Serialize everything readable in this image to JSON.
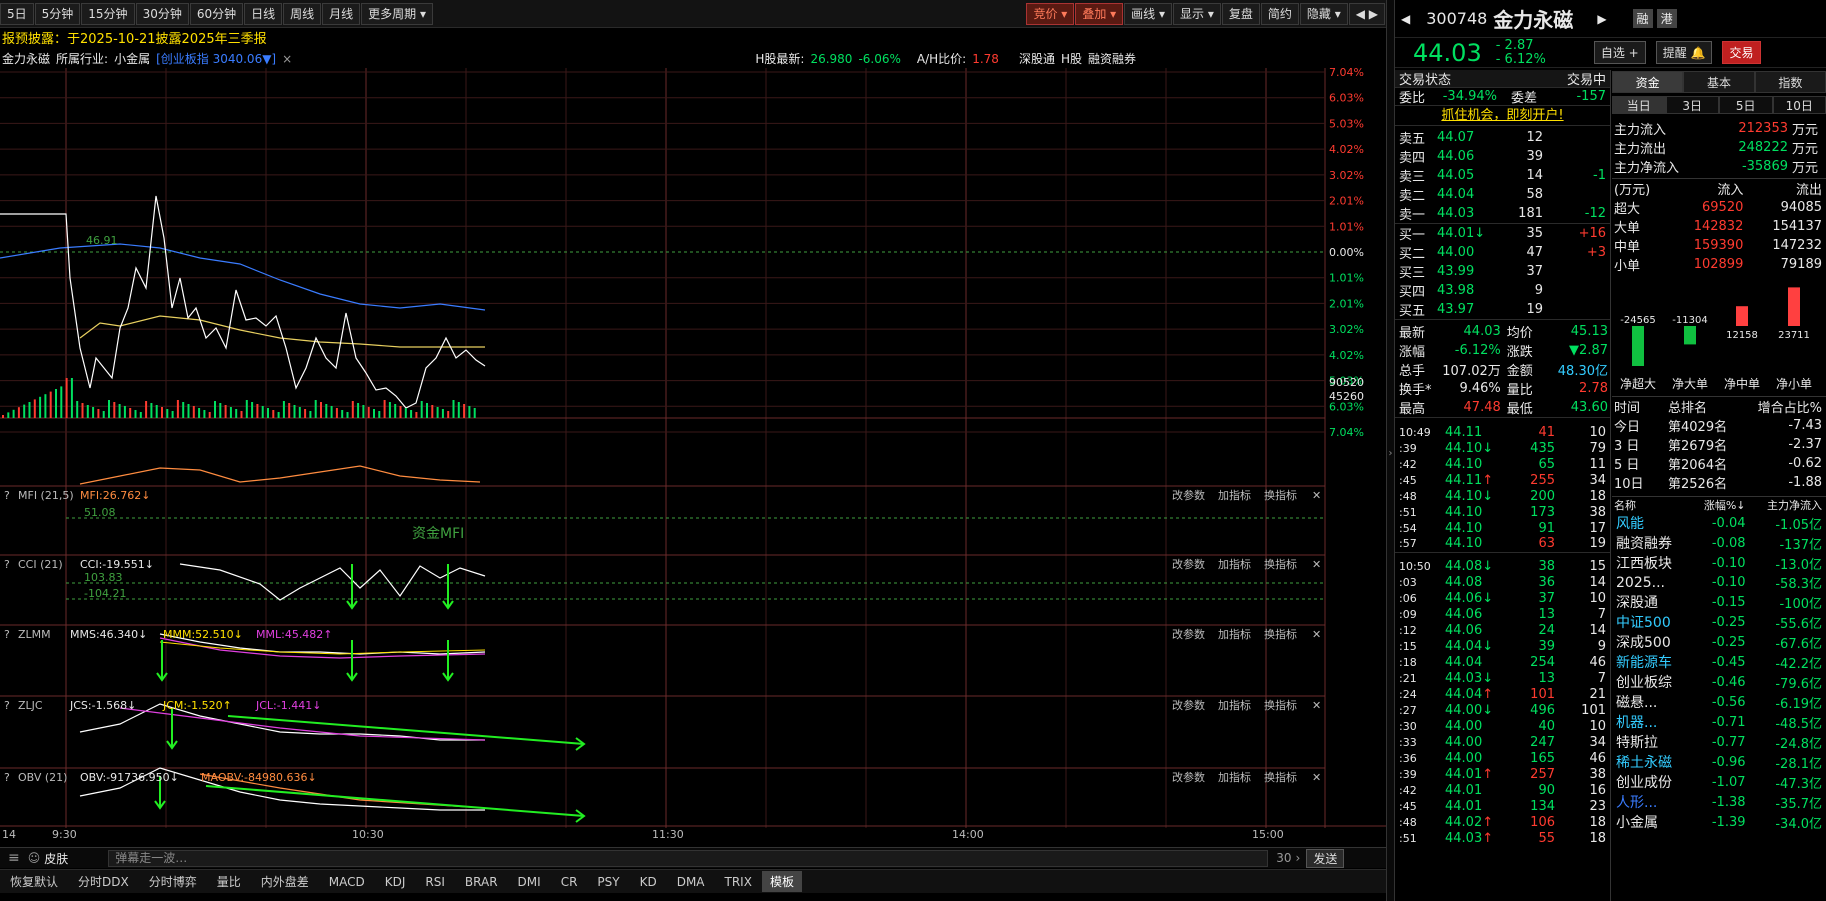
{
  "toolbar": {
    "left_buttons": [
      "5日",
      "5分钟",
      "15分钟",
      "30分钟",
      "60分钟",
      "日线",
      "周线",
      "月线",
      "更多周期"
    ],
    "right_buttons": [
      "竞价",
      "叠加",
      "画线",
      "显示",
      "复盘",
      "简约",
      "隐藏"
    ],
    "arrows": "◀ ▶"
  },
  "info_line": "报预披露：于2025-10-21披露2025年三季报",
  "chart_header": {
    "stock": "金力永磁",
    "industry_label": "所属行业:",
    "industry": "小金属",
    "index_tag": "[创业板指 3040.06▼]",
    "close": "×",
    "h_label": "H股最新:",
    "h_price": "26.980",
    "h_change": "-6.06%",
    "ah_label": "A/H比价:",
    "ah_value": "1.78",
    "links": [
      "深股通",
      "H股",
      "融资融券"
    ]
  },
  "chart": {
    "left_edge_label": "14",
    "time_labels": [
      "9:30",
      "10:30",
      "11:30",
      "14:00",
      "15:00"
    ],
    "right_axis": [
      "7.04%",
      "6.03%",
      "5.03%",
      "4.02%",
      "3.02%",
      "2.01%",
      "1.01%",
      "0.00%",
      "1.01%",
      "2.01%",
      "3.02%",
      "4.02%",
      "5.03%",
      "6.03%",
      "7.04%"
    ],
    "ref_line_label": "46.91",
    "volume_axis": [
      "90520",
      "45260"
    ],
    "panel_tools": [
      "改参数",
      "加指标",
      "换指标"
    ],
    "panels": [
      {
        "name": "MFI (21,5)",
        "values": [
          {
            "text": "MFI:26.762↓",
            "color": "#ff8c40"
          }
        ],
        "levels": [
          "51.08"
        ],
        "annotation": "资金MFI"
      },
      {
        "name": "CCI (21)",
        "values": [
          {
            "text": "CCI:-19.551↓",
            "color": "#e8e8e8"
          }
        ],
        "levels": [
          "103.83",
          "-104.21"
        ],
        "annotation": ""
      },
      {
        "name": "ZLMM",
        "values": [
          {
            "text": "MMS:46.340↓",
            "color": "#e8e8e8"
          },
          {
            "text": "MMM:52.510↓",
            "color": "#ffe000"
          },
          {
            "text": "MML:45.482↑",
            "color": "#e040e0"
          }
        ],
        "levels": [],
        "annotation": ""
      },
      {
        "name": "ZLJC",
        "values": [
          {
            "text": "JCS:-1.568↓",
            "color": "#e8e8e8"
          },
          {
            "text": "JCM:-1.520↑",
            "color": "#ffe000"
          },
          {
            "text": "JCL:-1.441↓",
            "color": "#e040e0"
          }
        ],
        "levels": [],
        "annotation": ""
      },
      {
        "name": "OBV (21)",
        "values": [
          {
            "text": "OBV:-91736.950↓",
            "color": "#e8e8e8"
          },
          {
            "text": "MAOBV:-84980.636↓",
            "color": "#ff8c40"
          }
        ],
        "levels": [],
        "annotation": ""
      }
    ]
  },
  "comment_bar": {
    "skin": "皮肤",
    "placeholder": "弹幕走一波…",
    "count": "30",
    "send": "发送"
  },
  "indicator_tabs": [
    "恢复默认",
    "分时DDX",
    "分时博弈",
    "量比",
    "内外盘差",
    "MACD",
    "KDJ",
    "RSI",
    "BRAR",
    "DMI",
    "CR",
    "PSY",
    "KD",
    "DMA",
    "TRIX",
    "模板"
  ],
  "right": {
    "code": "300748",
    "name": "金力永磁",
    "tags": [
      "融",
      "港"
    ],
    "price": "44.03",
    "change": "- 2.87",
    "change_pct": "- 6.12%",
    "buttons": [
      "自选 +",
      "提醒 🔔",
      "交易"
    ],
    "status_label": "交易状态",
    "status": "交易中",
    "weibi_label": "委比",
    "weibi": "-34.94%",
    "weicha_label": "委差",
    "weicha": "-157",
    "promo": "抓住机会，即刻开户!",
    "asks": [
      {
        "label": "卖五",
        "price": "44.07",
        "vol": "12",
        "chg": ""
      },
      {
        "label": "卖四",
        "price": "44.06",
        "vol": "39",
        "chg": ""
      },
      {
        "label": "卖三",
        "price": "44.05",
        "vol": "14",
        "chg": "-1"
      },
      {
        "label": "卖二",
        "price": "44.04",
        "vol": "58",
        "chg": ""
      },
      {
        "label": "卖一",
        "price": "44.03",
        "vol": "181",
        "chg": "-12"
      }
    ],
    "bids": [
      {
        "label": "买一",
        "price": "44.01↓",
        "vol": "35",
        "chg": "+16"
      },
      {
        "label": "买二",
        "price": "44.00",
        "vol": "47",
        "chg": "+3"
      },
      {
        "label": "买三",
        "price": "43.99",
        "vol": "37",
        "chg": ""
      },
      {
        "label": "买四",
        "price": "43.98",
        "vol": "9",
        "chg": ""
      },
      {
        "label": "买五",
        "price": "43.97",
        "vol": "19",
        "chg": ""
      }
    ],
    "stats": [
      [
        {
          "l": "最新",
          "v": "44.03",
          "c": "green"
        },
        {
          "l": "均价",
          "v": "45.13",
          "c": "green"
        }
      ],
      [
        {
          "l": "涨幅",
          "v": "-6.12%",
          "c": "green"
        },
        {
          "l": "涨跌",
          "v": "▼2.87",
          "c": "green"
        }
      ],
      [
        {
          "l": "总手",
          "v": "107.02万",
          "c": "white"
        },
        {
          "l": "金额",
          "v": "48.30亿",
          "c": "cyan"
        }
      ],
      [
        {
          "l": "换手*",
          "v": "9.46%",
          "c": "white"
        },
        {
          "l": "量比",
          "v": "2.78",
          "c": "red"
        }
      ],
      [
        {
          "l": "最高",
          "v": "47.48",
          "c": "red"
        },
        {
          "l": "最低",
          "v": "43.60",
          "c": "green"
        }
      ]
    ],
    "ticks1": [
      {
        "t": "10:49",
        "p": "44.11",
        "a": "",
        "v": "41",
        "vc": "red",
        "n": "10"
      },
      {
        "t": ":39",
        "p": "44.10",
        "a": "↓",
        "v": "435",
        "vc": "green",
        "n": "79"
      },
      {
        "t": ":42",
        "p": "44.10",
        "a": "",
        "v": "65",
        "vc": "green",
        "n": "11"
      },
      {
        "t": ":45",
        "p": "44.11",
        "a": "↑",
        "v": "255",
        "vc": "red",
        "n": "34"
      },
      {
        "t": ":48",
        "p": "44.10",
        "a": "↓",
        "v": "200",
        "vc": "green",
        "n": "18"
      },
      {
        "t": ":51",
        "p": "44.10",
        "a": "",
        "v": "173",
        "vc": "green",
        "n": "38"
      },
      {
        "t": ":54",
        "p": "44.10",
        "a": "",
        "v": "91",
        "vc": "green",
        "n": "17"
      },
      {
        "t": ":57",
        "p": "44.10",
        "a": "",
        "v": "63",
        "vc": "red",
        "n": "19"
      }
    ],
    "ticks2": [
      {
        "t": "10:50",
        "p": "44.08",
        "a": "↓",
        "v": "38",
        "vc": "green",
        "n": "15"
      },
      {
        "t": ":03",
        "p": "44.08",
        "a": "",
        "v": "36",
        "vc": "green",
        "n": "14"
      },
      {
        "t": ":06",
        "p": "44.06",
        "a": "↓",
        "v": "37",
        "vc": "green",
        "n": "10"
      },
      {
        "t": ":09",
        "p": "44.06",
        "a": "",
        "v": "13",
        "vc": "green",
        "n": "7"
      },
      {
        "t": ":12",
        "p": "44.06",
        "a": "",
        "v": "24",
        "vc": "green",
        "n": "14"
      },
      {
        "t": ":15",
        "p": "44.04",
        "a": "↓",
        "v": "39",
        "vc": "green",
        "n": "9"
      },
      {
        "t": ":18",
        "p": "44.04",
        "a": "",
        "v": "254",
        "vc": "green",
        "n": "46"
      },
      {
        "t": ":21",
        "p": "44.03",
        "a": "↓",
        "v": "13",
        "vc": "green",
        "n": "7"
      },
      {
        "t": ":24",
        "p": "44.04",
        "a": "↑",
        "v": "101",
        "vc": "red",
        "n": "21"
      },
      {
        "t": ":27",
        "p": "44.00",
        "a": "↓",
        "v": "496",
        "vc": "green",
        "n": "101"
      },
      {
        "t": ":30",
        "p": "44.00",
        "a": "",
        "v": "40",
        "vc": "green",
        "n": "10"
      },
      {
        "t": ":33",
        "p": "44.00",
        "a": "",
        "v": "247",
        "vc": "green",
        "n": "34"
      },
      {
        "t": ":36",
        "p": "44.00",
        "a": "",
        "v": "165",
        "vc": "green",
        "n": "46"
      },
      {
        "t": ":39",
        "p": "44.01",
        "a": "↑",
        "v": "257",
        "vc": "red",
        "n": "38"
      },
      {
        "t": ":42",
        "p": "44.01",
        "a": "",
        "v": "90",
        "vc": "green",
        "n": "16"
      },
      {
        "t": ":45",
        "p": "44.01",
        "a": "",
        "v": "134",
        "vc": "green",
        "n": "23"
      },
      {
        "t": ":48",
        "p": "44.02",
        "a": "↑",
        "v": "106",
        "vc": "red",
        "n": "18"
      },
      {
        "t": ":51",
        "p": "44.03",
        "a": "↑",
        "v": "55",
        "vc": "red",
        "n": "18"
      }
    ],
    "fund_tabs": [
      "资金",
      "基本",
      "指数"
    ],
    "period_tabs": [
      "当日",
      "3日",
      "5日",
      "10日"
    ],
    "flows": [
      {
        "l": "主力流入",
        "v": "212353",
        "u": "万元",
        "c": "red"
      },
      {
        "l": "主力流出",
        "v": "248222",
        "u": "万元",
        "c": "green"
      },
      {
        "l": "主力净流入",
        "v": "-35869",
        "u": "万元",
        "c": "green"
      }
    ],
    "flow_table_header": [
      "(万元)",
      "流入",
      "流出"
    ],
    "flow_table": [
      {
        "l": "超大",
        "in": "69520",
        "out": "94085"
      },
      {
        "l": "大单",
        "in": "142832",
        "out": "154137"
      },
      {
        "l": "中单",
        "in": "159390",
        "out": "147232"
      },
      {
        "l": "小单",
        "in": "102899",
        "out": "79189"
      }
    ],
    "net_chart": {
      "categories": [
        "净超大",
        "净大单",
        "净中单",
        "净小单"
      ],
      "values": [
        -24565,
        -11304,
        12158,
        23711
      ]
    },
    "rank_header": [
      "时间",
      "总排名",
      "增合占比%"
    ],
    "rank": [
      {
        "t": "今日",
        "r": "第4029名",
        "p": "-7.43"
      },
      {
        "t": "3 日",
        "r": "第2679名",
        "p": "-2.37"
      },
      {
        "t": "5 日",
        "r": "第2064名",
        "p": "-0.62"
      },
      {
        "t": "10日",
        "r": "第2526名",
        "p": "-1.88"
      }
    ],
    "sector_header": [
      "名称",
      "涨幅%↓",
      "主力净流入"
    ],
    "sectors": [
      {
        "n": "风能",
        "c": "cyan",
        "p": "-0.04",
        "f": "-1.05亿"
      },
      {
        "n": "融资融券",
        "c": "white",
        "p": "-0.08",
        "f": "-137亿"
      },
      {
        "n": "江西板块",
        "c": "white",
        "p": "-0.10",
        "f": "-13.0亿"
      },
      {
        "n": "2025...",
        "c": "white",
        "p": "-0.10",
        "f": "-58.3亿"
      },
      {
        "n": "深股通",
        "c": "white",
        "p": "-0.15",
        "f": "-100亿"
      },
      {
        "n": "中证500",
        "c": "cyan",
        "p": "-0.25",
        "f": "-55.6亿"
      },
      {
        "n": "深成500",
        "c": "white",
        "p": "-0.25",
        "f": "-67.6亿"
      },
      {
        "n": "新能源车",
        "c": "cyan",
        "p": "-0.45",
        "f": "-42.2亿"
      },
      {
        "n": "创业板综",
        "c": "white",
        "p": "-0.46",
        "f": "-79.6亿"
      },
      {
        "n": "磁悬...",
        "c": "white",
        "p": "-0.56",
        "f": "-6.19亿"
      },
      {
        "n": "机器...",
        "c": "cyan",
        "p": "-0.71",
        "f": "-48.5亿"
      },
      {
        "n": "特斯拉",
        "c": "white",
        "p": "-0.77",
        "f": "-24.8亿"
      },
      {
        "n": "稀土永磁",
        "c": "cyan",
        "p": "-0.96",
        "f": "-28.1亿"
      },
      {
        "n": "创业成份",
        "c": "white",
        "p": "-1.07",
        "f": "-47.3亿"
      },
      {
        "n": "人形...",
        "c": "blue",
        "p": "-1.38",
        "f": "-35.7亿"
      },
      {
        "n": "小金属",
        "c": "white",
        "p": "-1.39",
        "f": "-34.0亿"
      }
    ]
  }
}
